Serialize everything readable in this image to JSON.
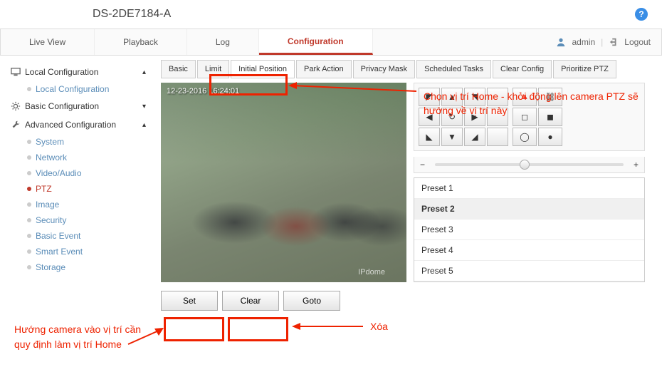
{
  "header": {
    "model": "DS-2DE7184-A"
  },
  "nav": {
    "tabs": [
      "Live View",
      "Playback",
      "Log",
      "Configuration"
    ],
    "user": "admin",
    "logout": "Logout"
  },
  "sidebar": {
    "local": {
      "title": "Local Configuration",
      "items": [
        "Local Configuration"
      ]
    },
    "basic": {
      "title": "Basic Configuration"
    },
    "advanced": {
      "title": "Advanced Configuration",
      "items": [
        "System",
        "Network",
        "Video/Audio",
        "PTZ",
        "Image",
        "Security",
        "Basic Event",
        "Smart Event",
        "Storage"
      ]
    }
  },
  "subtabs": [
    "Basic",
    "Limit",
    "Initial Position",
    "Park Action",
    "Privacy Mask",
    "Scheduled Tasks",
    "Clear Config",
    "Prioritize PTZ"
  ],
  "video": {
    "timestamp": "12-23-2016   16:24:01",
    "watermark": "IPdome"
  },
  "presets": [
    "Preset 1",
    "Preset 2",
    "Preset 3",
    "Preset 4",
    "Preset 5"
  ],
  "actions": {
    "set": "Set",
    "clear": "Clear",
    "goto": "Goto"
  },
  "slider": {
    "minus": "−",
    "plus": "+"
  },
  "annotations": {
    "top": "Chọn vị trí Home - khởi động lên camera PTZ sẽ hướng về vị trí này",
    "mid": "Xóa",
    "left": "Hướng camera vào vị trí cần quy định làm vị trí Home"
  }
}
